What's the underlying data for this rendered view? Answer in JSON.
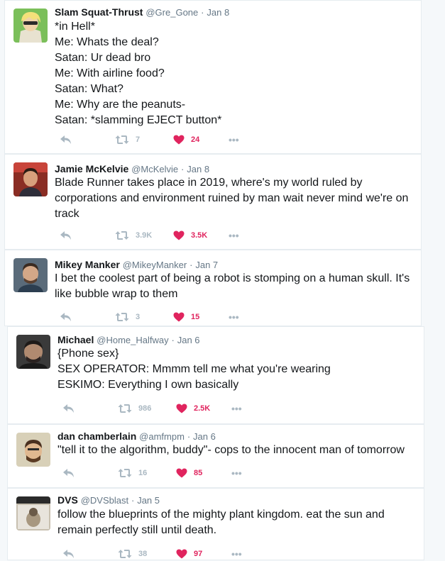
{
  "tweets": [
    {
      "name": "Slam Squat-Thrust",
      "handle": "@Gre_Gone",
      "date": "Jan 8",
      "text": "*in Hell*\nMe: Whats the deal?\nSatan: Ur dead bro\nMe: With airline food?\nSatan: What?\nMe: Why are the peanuts-\nSatan: *slamming EJECT button*",
      "retweets": "7",
      "likes": "24"
    },
    {
      "name": "Jamie McKelvie",
      "handle": "@McKelvie",
      "date": "Jan 8",
      "text": "Blade Runner takes place in 2019, where's my world ruled by corporations and environment ruined by man wait never mind we're on track",
      "retweets": "3.9K",
      "likes": "3.5K"
    },
    {
      "name": "Mikey Manker",
      "handle": "@MikeyManker",
      "date": "Jan 7",
      "text": "I bet the coolest part of being a robot is stomping on a human skull. It's like bubble wrap to them",
      "retweets": "3",
      "likes": "15"
    },
    {
      "name": "Michael",
      "handle": "@Home_Halfway",
      "date": "Jan 6",
      "text": "{Phone sex}\nSEX OPERATOR: Mmmm tell me what you're wearing\nESKIMO: Everything I own basically",
      "retweets": "986",
      "likes": "2.5K"
    },
    {
      "name": "dan chamberlain",
      "handle": "@amfmpm",
      "date": "Jan 6",
      "text": "\"tell it to the algorithm, buddy\"- cops to the innocent man of tomorrow",
      "retweets": "16",
      "likes": "85"
    },
    {
      "name": "DVS",
      "handle": "@DVSblast",
      "date": "Jan 5",
      "text": "follow the blueprints of the mighty plant kingdom. eat the sun and remain perfectly still until death.",
      "retweets": "38",
      "likes": "97"
    }
  ],
  "icons": {
    "reply": "reply-icon",
    "retweet": "retweet-icon",
    "like": "heart-icon",
    "more": "more-icon"
  },
  "colors": {
    "like": "#e0245e",
    "icon": "#aab8c2",
    "meta": "#657786",
    "border": "#e6ecf0"
  },
  "ui": {
    "more_label": "•••",
    "separator": "·"
  }
}
